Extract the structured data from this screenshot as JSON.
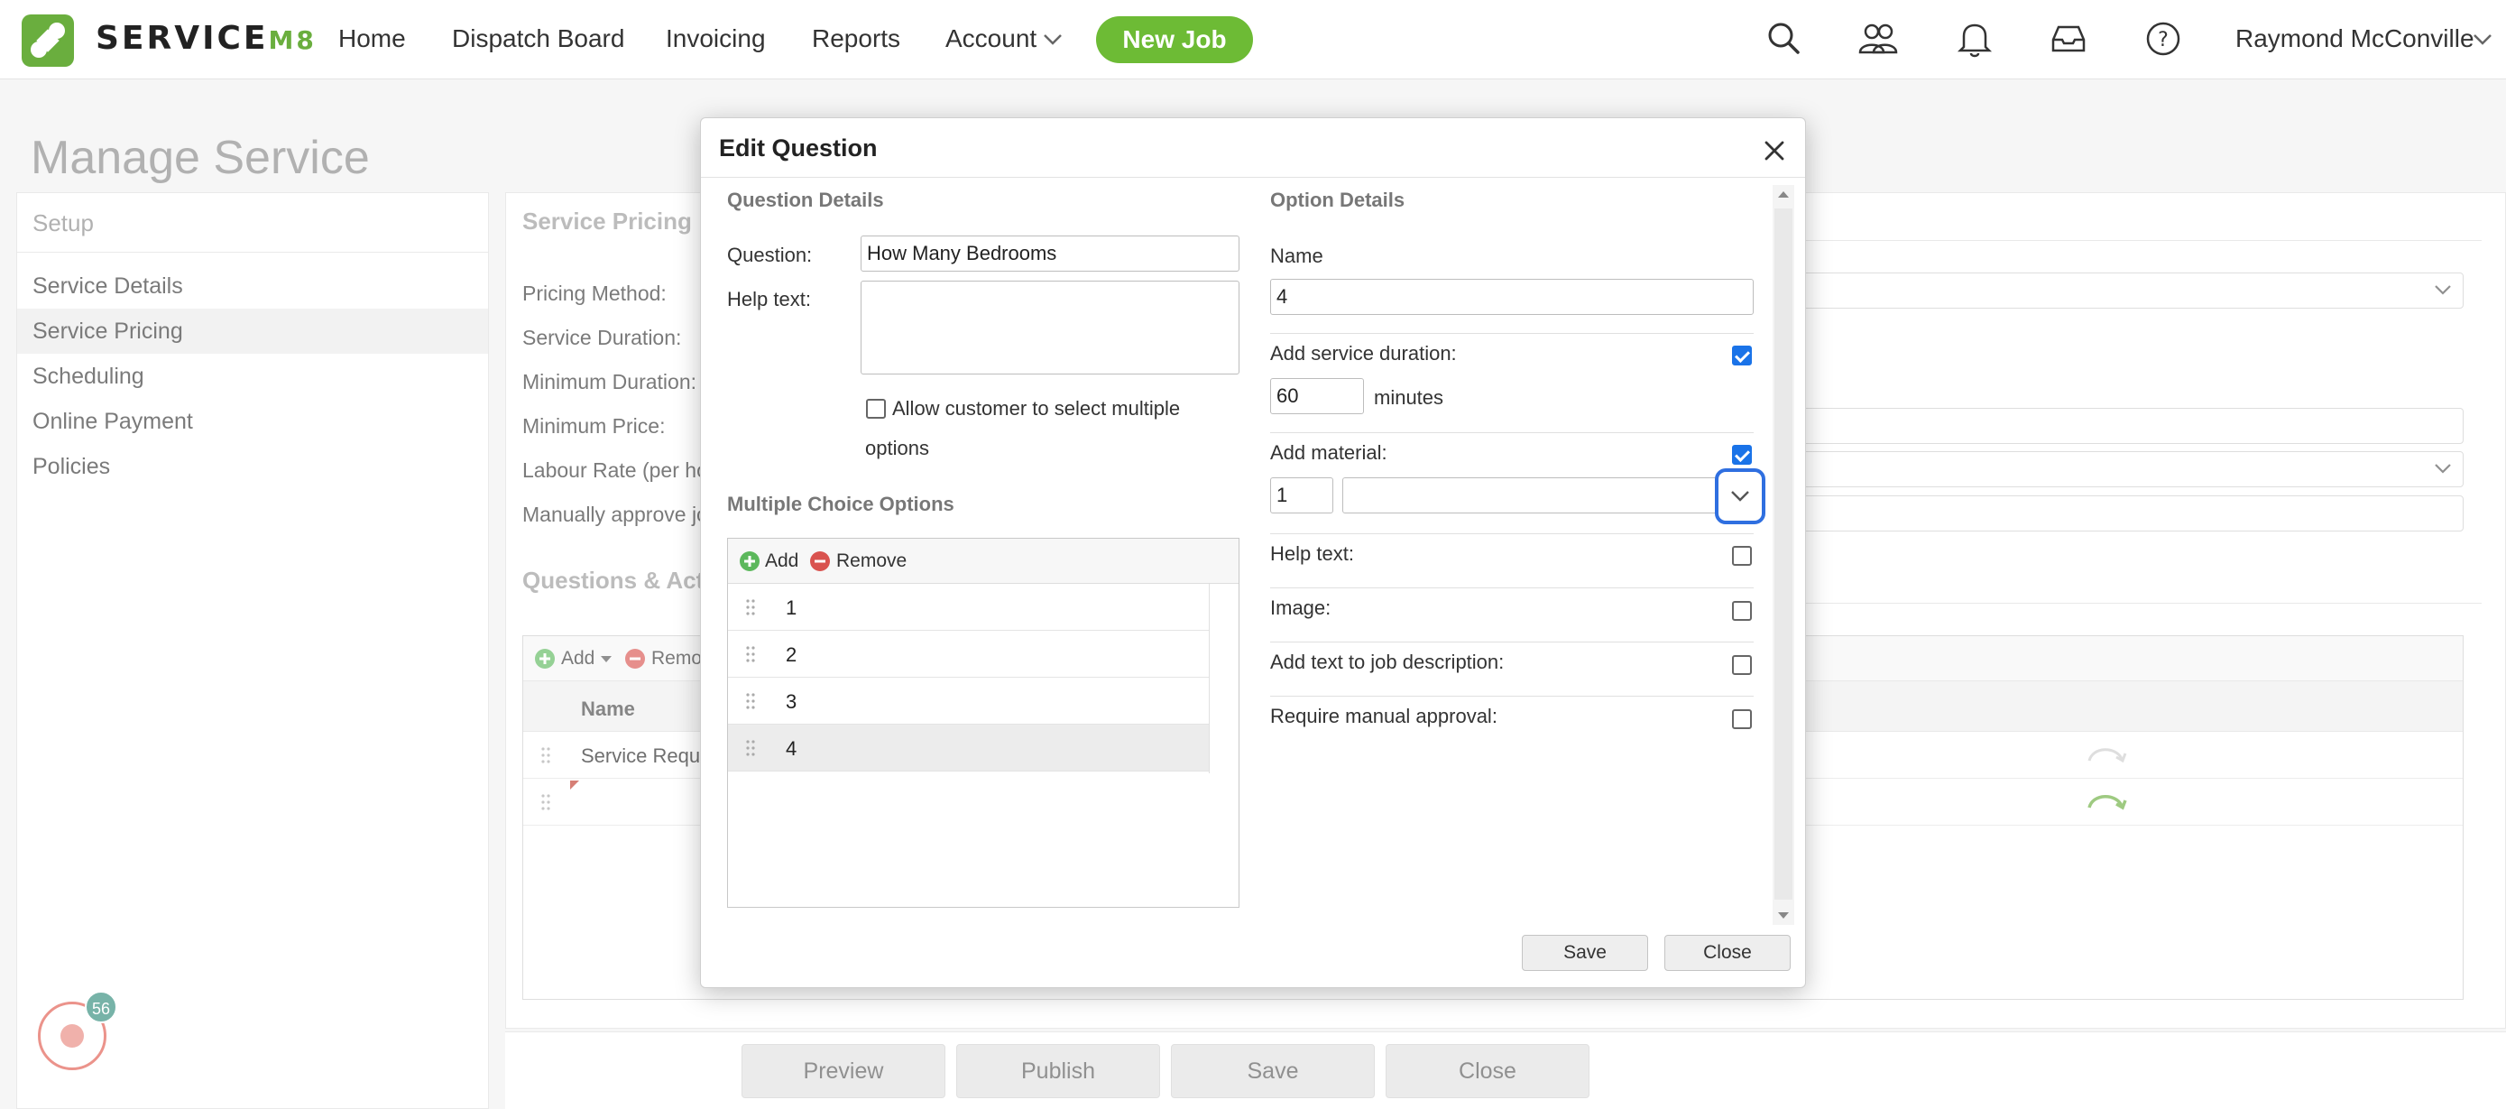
{
  "app": {
    "logo_word": "SERVICE",
    "logo_suffix": "M8",
    "nav": [
      "Home",
      "Dispatch Board",
      "Invoicing",
      "Reports",
      "Account"
    ],
    "new_job": "New Job",
    "user_name": "Raymond McConville",
    "accent_color": "#6dbb35"
  },
  "page": {
    "title": "Manage Service",
    "sidebar": {
      "heading": "Setup",
      "items": [
        "Service Details",
        "Service Pricing",
        "Scheduling",
        "Online Payment",
        "Policies"
      ]
    },
    "pricing": {
      "section_title": "Service Pricing",
      "labels": [
        "Pricing Method:",
        "Service Duration:",
        "Minimum Duration:",
        "Minimum Price:",
        "Labour Rate (per hou",
        "Manually approve jo"
      ]
    },
    "qa": {
      "section_title": "Questions & Actio",
      "add": "Add",
      "remove": "Remo",
      "col_name": "Name",
      "rows": [
        "Service Requi",
        ""
      ]
    },
    "bottom_buttons": [
      "Preview",
      "Publish",
      "Save",
      "Close"
    ],
    "help_badge": "56"
  },
  "dialog": {
    "title": "Edit Question",
    "question_details": {
      "heading": "Question Details",
      "question_label": "Question:",
      "question_value": "How Many Bedrooms",
      "help_label": "Help text:",
      "help_value": "",
      "allow_multi_line1": "Allow customer to select multiple",
      "allow_multi_line2": "options",
      "allow_multi_checked": false
    },
    "multiple_choice": {
      "heading": "Multiple Choice Options",
      "add": "Add",
      "remove": "Remove",
      "options": [
        "1",
        "2",
        "3",
        "4"
      ],
      "selected_index": 3
    },
    "option_details": {
      "heading": "Option Details",
      "name_label": "Name",
      "name_value": "4",
      "duration_label": "Add service duration:",
      "duration_checked": true,
      "duration_value": "60",
      "duration_unit": "minutes",
      "material_label": "Add material:",
      "material_checked": true,
      "material_qty": "1",
      "material_value": "",
      "help_label": "Help text:",
      "help_checked": false,
      "image_label": "Image:",
      "image_checked": false,
      "add_desc_label": "Add text to job description:",
      "add_desc_checked": false,
      "manual_label": "Require manual approval:",
      "manual_checked": false
    },
    "save": "Save",
    "close": "Close"
  }
}
